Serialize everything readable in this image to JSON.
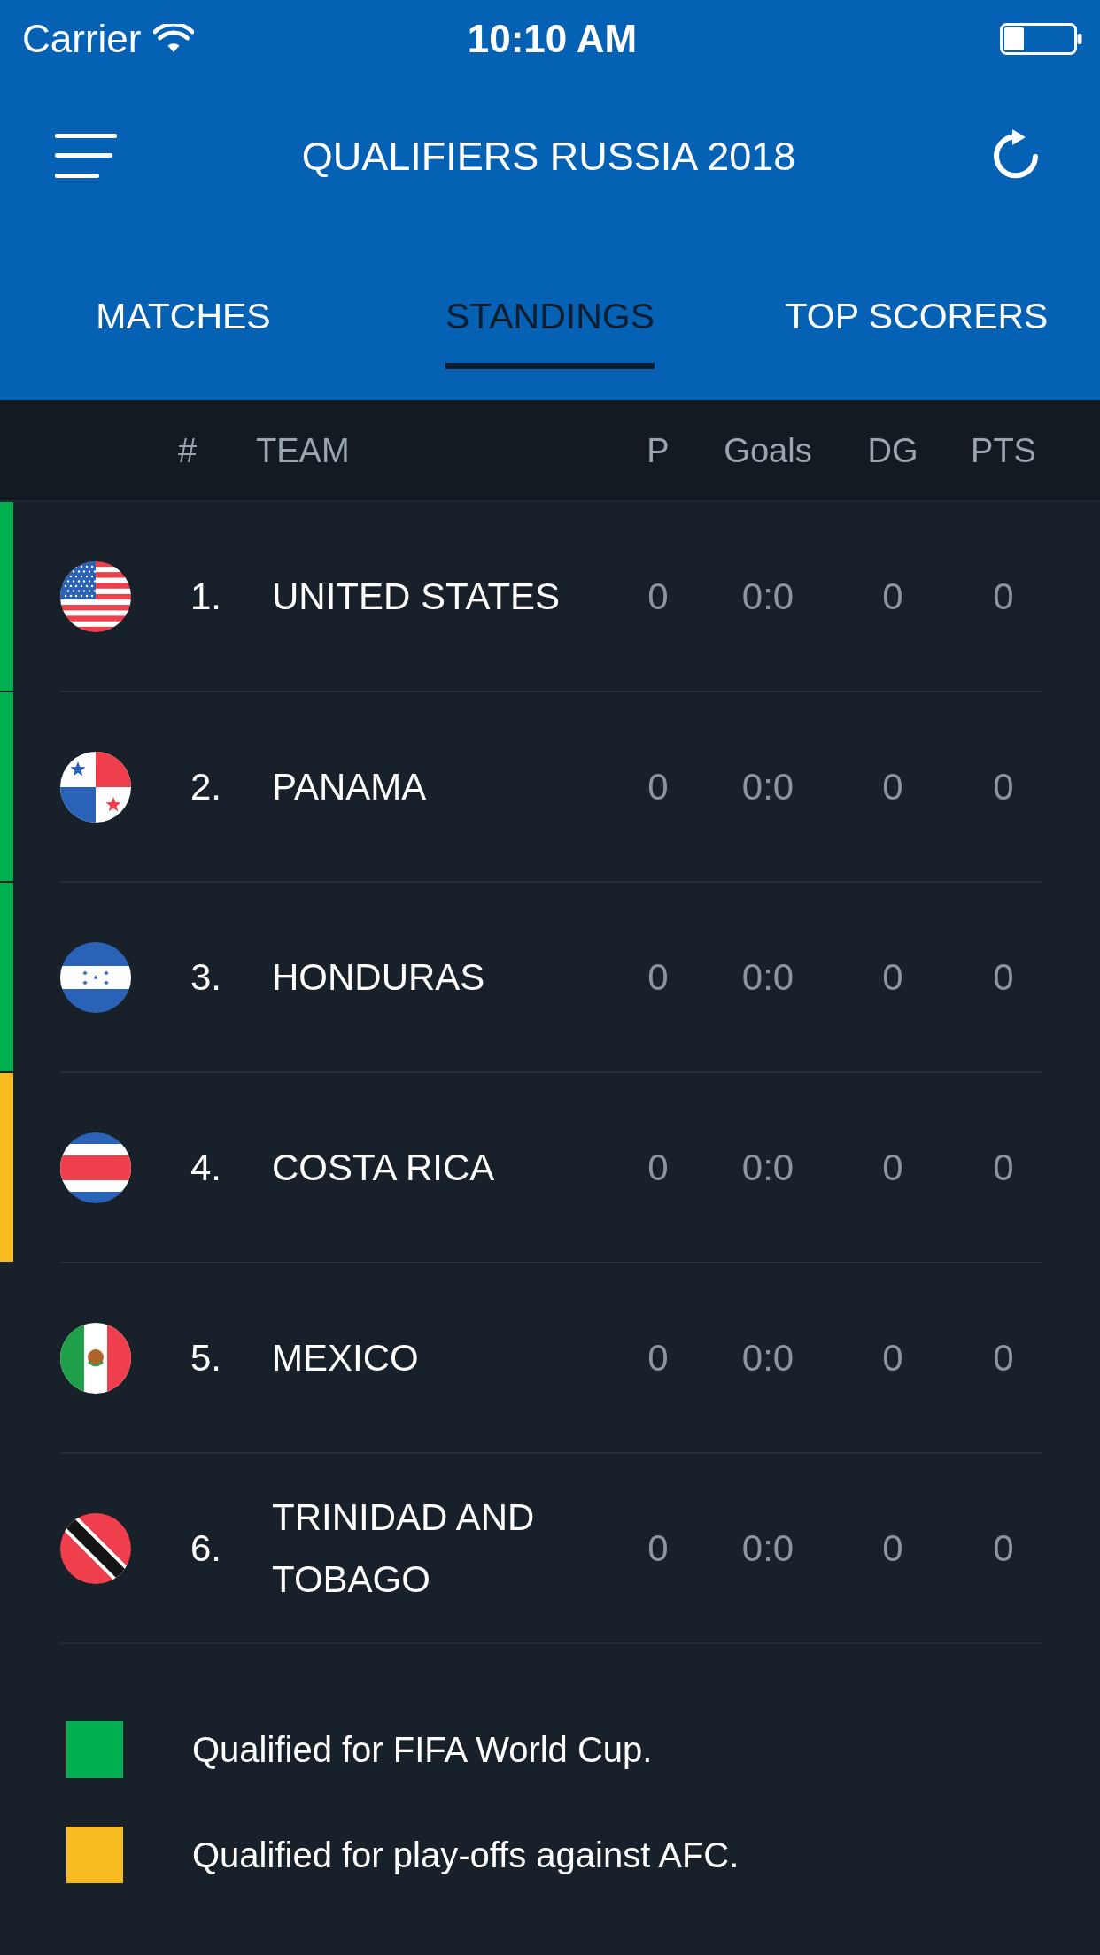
{
  "status_bar": {
    "carrier": "Carrier",
    "time": "10:10 AM"
  },
  "nav_bar": {
    "title": "QUALIFIERS RUSSIA 2018"
  },
  "tabs": [
    {
      "label": "MATCHES",
      "selected": false
    },
    {
      "label": "STANDINGS",
      "selected": true
    },
    {
      "label": "TOP SCORERS",
      "selected": false
    }
  ],
  "table": {
    "columns": [
      "#",
      "TEAM",
      "P",
      "Goals",
      "DG",
      "PTS"
    ],
    "rows": [
      {
        "rank": "1.",
        "team": "UNITED STATES",
        "played": "0",
        "goals": "0:0",
        "goal_difference": "0",
        "points": "0",
        "color": "#00b050"
      },
      {
        "rank": "2.",
        "team": "PANAMA",
        "played": "0",
        "goals": "0:0",
        "goal_difference": "0",
        "points": "0",
        "color": "#00b050"
      },
      {
        "rank": "3.",
        "team": "HONDURAS",
        "played": "0",
        "goals": "0:0",
        "goal_difference": "0",
        "points": "0",
        "color": "#00b050"
      },
      {
        "rank": "4.",
        "team": "COSTA RICA",
        "played": "0",
        "goals": "0:0",
        "goal_difference": "0",
        "points": "0",
        "color": "#f8bb22"
      },
      {
        "rank": "5.",
        "team": "MEXICO",
        "played": "0",
        "goals": "0:0",
        "goal_difference": "0",
        "points": "0"
      },
      {
        "rank": "6.",
        "team": "TRINIDAD AND TOBAGO",
        "played": "0",
        "goals": "0:0",
        "goal_difference": "0",
        "points": "0"
      }
    ]
  },
  "legend": [
    {
      "label": "Qualified for FIFA World Cup.",
      "color": "#00b050"
    },
    {
      "label": "Qualified for play-offs against AFC.",
      "color": "#f8bb22"
    }
  ]
}
